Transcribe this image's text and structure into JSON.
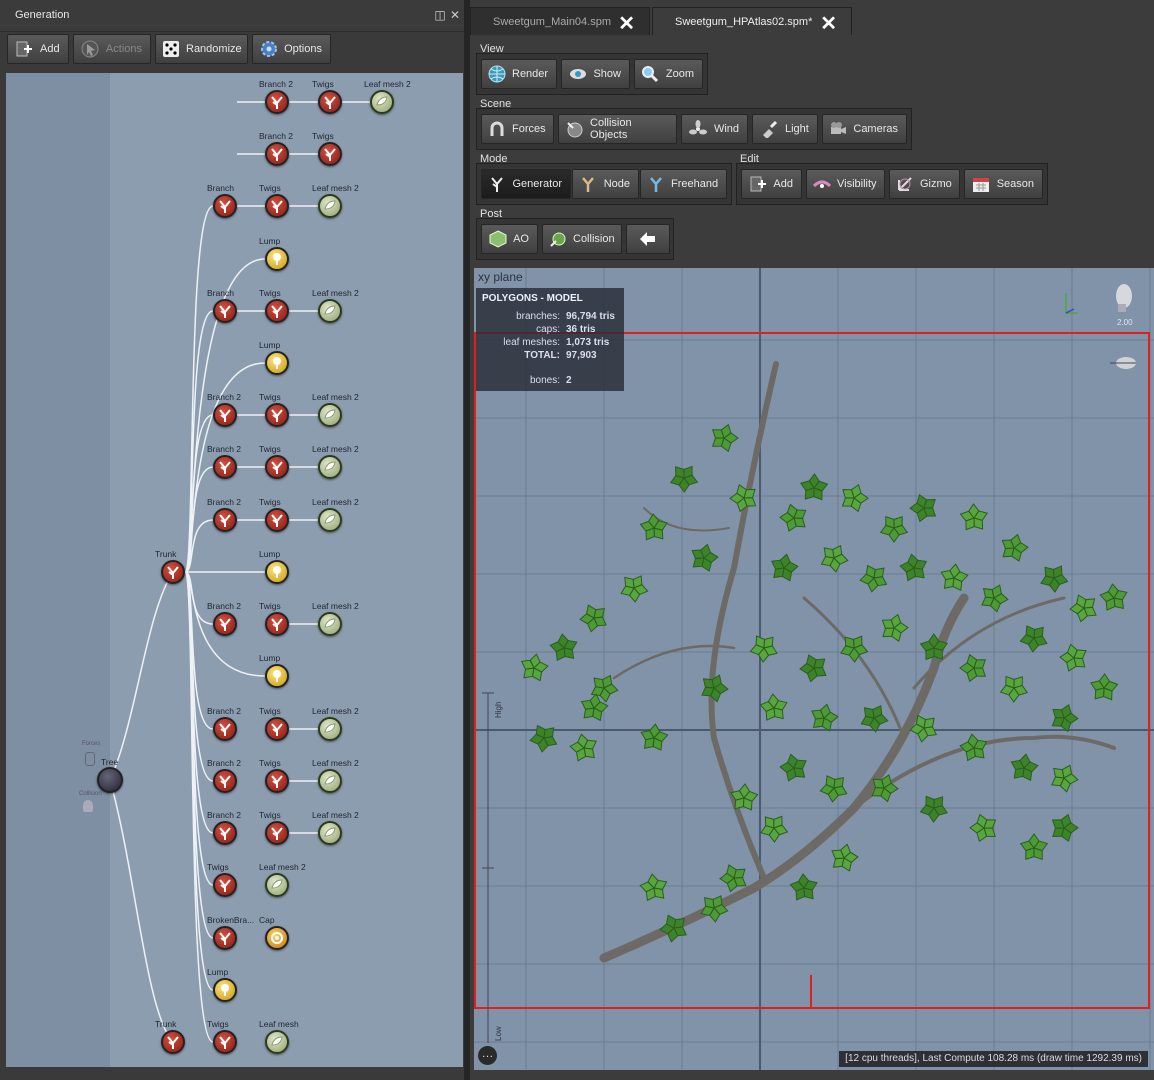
{
  "left_panel": {
    "title": "Generation",
    "toolbar": {
      "add": "Add",
      "actions": "Actions",
      "randomize": "Randomize",
      "options": "Options"
    },
    "graph": {
      "left_labels": {
        "forces": "Forces",
        "collision": "Collision"
      },
      "tree": "Tree",
      "nodes": [
        {
          "kind": "branch",
          "label": "Branch 2"
        },
        {
          "kind": "branch",
          "label": "Twigs"
        },
        {
          "kind": "leaf",
          "label": "Leaf mesh 2"
        },
        {
          "kind": "branch",
          "label": "Branch 2"
        },
        {
          "kind": "branch",
          "label": "Twigs"
        },
        {
          "kind": "branch",
          "label": "Branch"
        },
        {
          "kind": "branch",
          "label": "Twigs"
        },
        {
          "kind": "leaf",
          "label": "Leaf mesh 2"
        },
        {
          "kind": "lump",
          "label": "Lump"
        },
        {
          "kind": "branch",
          "label": "Branch"
        },
        {
          "kind": "branch",
          "label": "Twigs"
        },
        {
          "kind": "leaf",
          "label": "Leaf mesh 2"
        },
        {
          "kind": "lump",
          "label": "Lump"
        },
        {
          "kind": "branch",
          "label": "Branch 2"
        },
        {
          "kind": "branch",
          "label": "Twigs"
        },
        {
          "kind": "leaf",
          "label": "Leaf mesh 2"
        },
        {
          "kind": "branch",
          "label": "Branch 2"
        },
        {
          "kind": "branch",
          "label": "Twigs"
        },
        {
          "kind": "leaf",
          "label": "Leaf mesh 2"
        },
        {
          "kind": "branch",
          "label": "Branch 2"
        },
        {
          "kind": "branch",
          "label": "Twigs"
        },
        {
          "kind": "leaf",
          "label": "Leaf mesh 2"
        },
        {
          "kind": "lump",
          "label": "Lump"
        },
        {
          "kind": "branch",
          "label": "Trunk"
        },
        {
          "kind": "branch",
          "label": "Branch 2"
        },
        {
          "kind": "branch",
          "label": "Twigs"
        },
        {
          "kind": "leaf",
          "label": "Leaf mesh 2"
        },
        {
          "kind": "lump",
          "label": "Lump"
        },
        {
          "kind": "branch",
          "label": "Branch 2"
        },
        {
          "kind": "branch",
          "label": "Twigs"
        },
        {
          "kind": "leaf",
          "label": "Leaf mesh 2"
        },
        {
          "kind": "branch",
          "label": "Branch 2"
        },
        {
          "kind": "branch",
          "label": "Twigs"
        },
        {
          "kind": "leaf",
          "label": "Leaf mesh 2"
        },
        {
          "kind": "branch",
          "label": "Branch 2"
        },
        {
          "kind": "branch",
          "label": "Twigs"
        },
        {
          "kind": "leaf",
          "label": "Leaf mesh 2"
        },
        {
          "kind": "branch",
          "label": "Twigs"
        },
        {
          "kind": "leaf",
          "label": "Leaf mesh 2"
        },
        {
          "kind": "branch",
          "label": "BrokenBra..."
        },
        {
          "kind": "cap",
          "label": "Cap"
        },
        {
          "kind": "lump",
          "label": "Lump"
        },
        {
          "kind": "branch",
          "label": "Trunk"
        },
        {
          "kind": "branch",
          "label": "Twigs"
        },
        {
          "kind": "leaf",
          "label": "Leaf mesh"
        }
      ]
    }
  },
  "tabs": [
    {
      "label": "Sweetgum_Main04.spm",
      "active": false
    },
    {
      "label": "Sweetgum_HPAtlas02.spm*",
      "active": true
    }
  ],
  "groups": {
    "view": {
      "label": "View",
      "buttons": [
        "Render",
        "Show",
        "Zoom"
      ]
    },
    "scene": {
      "label": "Scene",
      "buttons": [
        "Forces",
        "Collision Objects",
        "Wind",
        "Light",
        "Cameras"
      ]
    },
    "mode": {
      "label": "Mode",
      "buttons": [
        "Generator",
        "Node",
        "Freehand"
      ]
    },
    "edit": {
      "label": "Edit",
      "buttons": [
        "Add",
        "Visibility",
        "Gizmo",
        "Season"
      ]
    },
    "post": {
      "label": "Post",
      "buttons": [
        "AO",
        "Collision"
      ]
    }
  },
  "viewport": {
    "plane_label": "xy plane",
    "light_value": "2.00",
    "stats": {
      "title": "POLYGONS - MODEL",
      "branches_label": "branches:",
      "branches_value": "96,794 tris",
      "caps_label": "caps:",
      "caps_value": "36 tris",
      "leaf_label": "leaf meshes:",
      "leaf_value": "1,073 tris",
      "total_label": "TOTAL:",
      "total_value": "97,903",
      "bones_label": "bones:",
      "bones_value": "2"
    },
    "ruler_high": "High",
    "ruler_low": "Low",
    "status": "[12 cpu threads], Last Compute 108.28 ms (draw time 1292.39 ms)",
    "accent_color": "#e02020"
  }
}
